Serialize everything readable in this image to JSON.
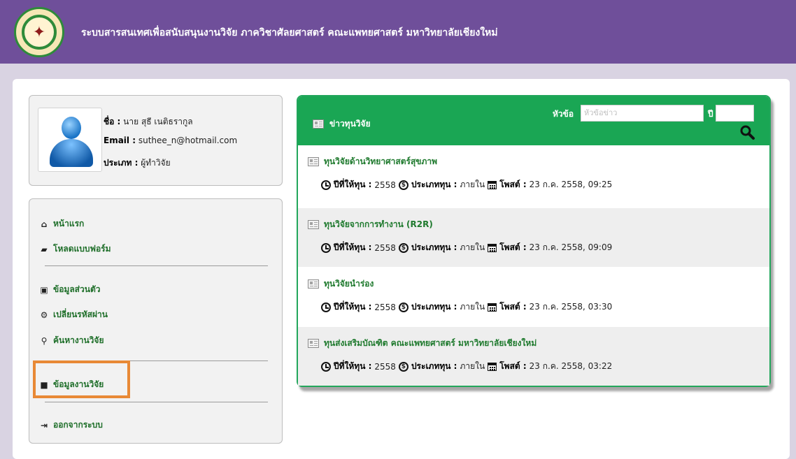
{
  "header": {
    "title": "ระบบสารสนเทศเพื่อสนับสนุนงานวิจัย ภาควิชาศัลยศาสตร์ คณะแพทยศาสตร์ มหาวิทยาลัยเชียงใหม่",
    "brand_color": "#6f4f9a"
  },
  "profile": {
    "name_label": "ชื่อ :",
    "name_value": "นาย สุธี เนติธรากูล",
    "email_label": "Email :",
    "email_value": "suthee_n@hotmail.com",
    "type_label": "ประเภท :",
    "type_value": "ผู้ทำวิจัย"
  },
  "menu": {
    "items": [
      {
        "label": "หน้าแรก",
        "icon": "home-icon"
      },
      {
        "label": "โหลดแบบฟอร์ม",
        "icon": "folder-open-icon"
      },
      {
        "label": "ข้อมูลส่วนตัว",
        "icon": "id-card-icon"
      },
      {
        "label": "เปลี่ยนรหัสผ่าน",
        "icon": "gears-icon"
      },
      {
        "label": "ค้นหางานวิจัย",
        "icon": "search-icon"
      },
      {
        "label": "ข้อมูลงานวิจัย",
        "icon": "book-icon"
      },
      {
        "label": "ออกจากระบบ",
        "icon": "logout-icon"
      }
    ],
    "highlight_color": "#e88936"
  },
  "news_panel": {
    "title": "ข่าวทุนวิจัย",
    "topic_label": "หัวข้อ",
    "topic_placeholder": "หัวข้อข่าว",
    "year_label": "ปี",
    "accent_color": "#1aa654",
    "meta_labels": {
      "year": "ปีที่ให้ทุน :",
      "type": "ประเภททุน :",
      "posted": "โพสต์ :"
    },
    "items": [
      {
        "title": "ทุนวิจัยด้านวิทยาศาสตร์สุขภาพ",
        "year": "2558",
        "type": "ภายใน",
        "posted": "23 ก.ค. 2558, 09:25"
      },
      {
        "title": "ทุนวิจัยจากการทำงาน (R2R)",
        "year": "2558",
        "type": "ภายใน",
        "posted": "23 ก.ค. 2558, 09:09"
      },
      {
        "title": "ทุนวิจัยนำร่อง",
        "year": "2558",
        "type": "ภายใน",
        "posted": "23 ก.ค. 2558, 03:30"
      },
      {
        "title": "ทุนส่งเสริมบัณฑิต คณะแพทยศาสตร์ มหาวิทยาลัยเชียงใหม่",
        "year": "2558",
        "type": "ภายใน",
        "posted": "23 ก.ค. 2558, 03:22"
      }
    ]
  }
}
